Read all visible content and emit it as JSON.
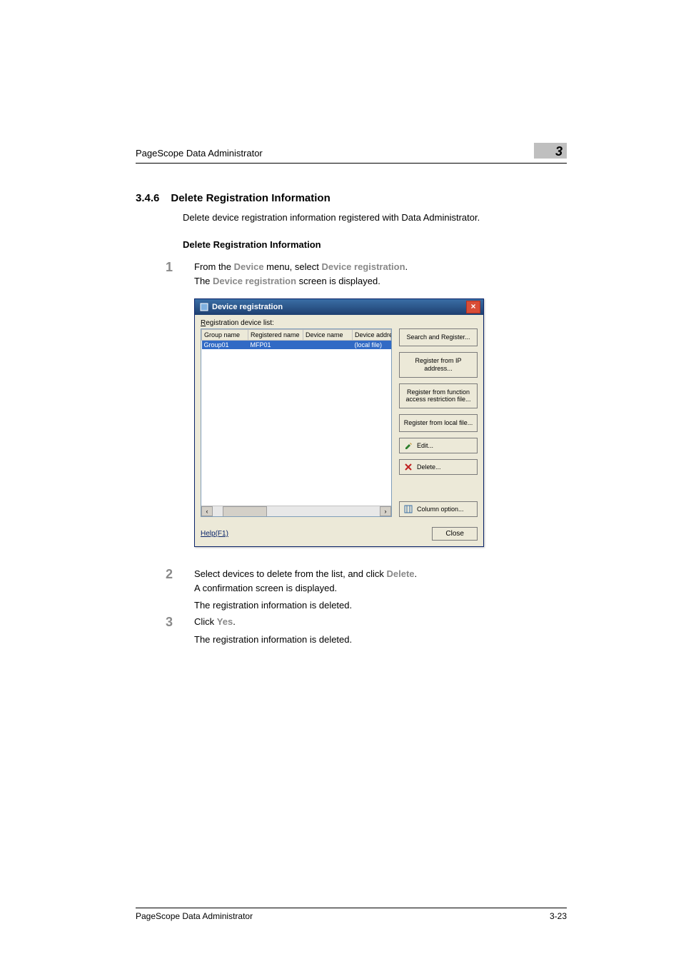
{
  "header": {
    "running_title": "PageScope Data Administrator",
    "chapter_number": "3"
  },
  "section": {
    "number": "3.4.6",
    "title": "Delete Registration Information",
    "intro": "Delete device registration information registered with Data Administrator.",
    "subheading": "Delete Registration Information"
  },
  "steps": [
    {
      "num": "1",
      "parts": [
        {
          "text": "From the "
        },
        {
          "text": "Device",
          "emph": true
        },
        {
          "text": " menu, select "
        },
        {
          "text": "Device registration",
          "emph": true
        },
        {
          "text": "."
        }
      ],
      "line2_parts": [
        {
          "text": "The "
        },
        {
          "text": "Device registration",
          "emph": true
        },
        {
          "text": " screen is displayed."
        }
      ]
    },
    {
      "num": "2",
      "parts": [
        {
          "text": "Select devices to delete from the list, and click "
        },
        {
          "text": "Delete",
          "emph": true
        },
        {
          "text": "."
        }
      ],
      "line2_parts": [
        {
          "text": "A confirmation screen is displayed."
        }
      ],
      "after": "The registration information is deleted."
    },
    {
      "num": "3",
      "parts": [
        {
          "text": "Click "
        },
        {
          "text": "Yes",
          "emph": true
        },
        {
          "text": "."
        }
      ],
      "after": "The registration information is deleted."
    }
  ],
  "dialog": {
    "title": "Device registration",
    "list_label_prefix": "R",
    "list_label_rest": "egistration device list:",
    "columns": [
      "Group name",
      "Registered name",
      "Device name",
      "Device address"
    ],
    "rows": [
      {
        "group": "Group01",
        "regname": "MFP01",
        "devname": "",
        "devaddr": "(local file)",
        "selected": true
      }
    ],
    "buttons": {
      "search_register": "Search and Register...",
      "register_ip": "Register from IP address...",
      "register_func": "Register from function access restriction file...",
      "register_local": "Register from local file...",
      "edit": "Edit...",
      "delete": "Delete...",
      "column_option": "Column option...",
      "close": "Close"
    },
    "help_label": "Help(F1)"
  },
  "footer": {
    "left": "PageScope Data Administrator",
    "right": "3-23"
  }
}
